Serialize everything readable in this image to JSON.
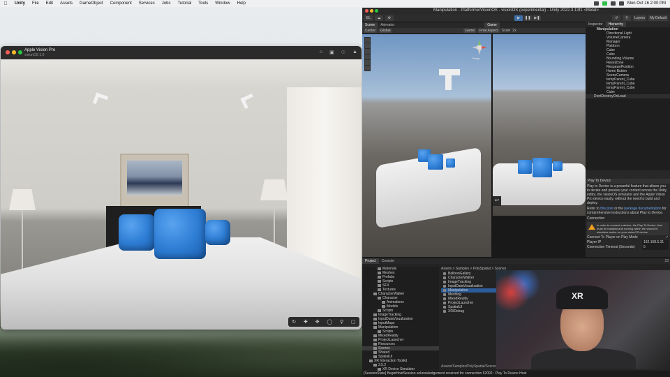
{
  "menubar": {
    "apple": "",
    "items": [
      "Unity",
      "File",
      "Edit",
      "Assets",
      "GameObject",
      "Component",
      "Services",
      "Jobs",
      "Tutorial",
      "Tools",
      "Window",
      "Help"
    ],
    "clock": "Mon Oct 16 2:00 PM"
  },
  "simulator": {
    "title": "Apple Vision Pro",
    "subtitle": "visionOS 1.0",
    "toolbar_icons": [
      "home-icon",
      "camera-icon",
      "record-icon",
      "device-icon"
    ]
  },
  "unity": {
    "title": "Manipulation - PlatformerVisionOS - visionOS (experimental) - Unity 2022.3.13f1 <Metal>",
    "toolbar": {
      "account": "EL",
      "layers": "Layers",
      "layout": "My Default"
    },
    "scene_tabs": [
      "Scene",
      "Animator"
    ],
    "game_tabs": [
      "Game"
    ],
    "inspector_tabs": [
      "Inspector",
      "Hierarchy"
    ],
    "scene_sub": [
      "Center",
      "Global"
    ],
    "game_sub": [
      "Game",
      "Free Aspect",
      "Scale",
      "2x"
    ],
    "gizmo_label": "Persp",
    "hierarchy": {
      "root": "Manipulation",
      "children": [
        "Directional Light",
        "VolumeCamera",
        "Manager",
        "Platform",
        "Cube",
        "Cube",
        "Bounding Volume",
        "ResetZone",
        "RespawnPosition",
        "Home Button",
        "SceneCamera",
        "tempParent_Cube",
        "tempParent_Cube",
        "tempParent_Cube",
        "Cube"
      ],
      "dont_destroy": "DontDestroyOnLoad"
    },
    "play_to_device": {
      "header": "Play To Device",
      "desc1": "Play to Device is a powerful feature that allows you to iterate and preview your content across the Unity editor, the visionOS simulator and the Apple Vision Pro device easily, without the need to build and deploy.",
      "desc2_pre": "Refer to ",
      "desc2_link1": "this post",
      "desc2_mid": " or the ",
      "desc2_link2": "package documentation",
      "desc2_post": " for comprehensive instructions about Play to Device.",
      "connection": "Connection",
      "warn": "In order to connect a device, the Play To Device Host must be installed and running within the visionOS simulator and/or on your visionOS device.",
      "connect_label": "Connect To Player on Play Mode",
      "player_ip_label": "Player IP",
      "player_ip": "192.168.5.31",
      "timeout_label": "Connection Timeout (Seconds)",
      "timeout": "5"
    },
    "project": {
      "tabs": [
        "Project",
        "Console"
      ],
      "tree": [
        "Materials",
        "Meshes",
        "Prefabs",
        "Scripts",
        "SFX",
        "Textures",
        "CharacterWalker",
        "Character",
        "Animations",
        "Models",
        "Scripts",
        "ImageTracking",
        "InputDataVisualization",
        "InputMaps",
        "Manipulation",
        "Scripts",
        "MixedReality",
        "ProjectLauncher",
        "Resources",
        "Scenes",
        "Shared",
        "SpatialUI",
        "XR Interaction Toolkit",
        "2.5.2",
        "XR Device Simulator"
      ],
      "breadcrumb": "Assets > Samples > PolySpatial > Scenes",
      "files": [
        "BalloonGallery",
        "CharacterWalker",
        "ImageTracking",
        "InputDataVisualization",
        "Manipulation",
        "Meshing",
        "MixedReality",
        "ProjectLauncher",
        "SpatialUI",
        "XRIDebug"
      ],
      "path": "Assets/Samples/PolySpatial/Scenes/Manipulation.unity",
      "count": "23"
    },
    "status": "[SessionState] BeginHostSession acknowledgement received for connection 52092 : Play To Device Host",
    "webcam_cap_text": "XR"
  }
}
